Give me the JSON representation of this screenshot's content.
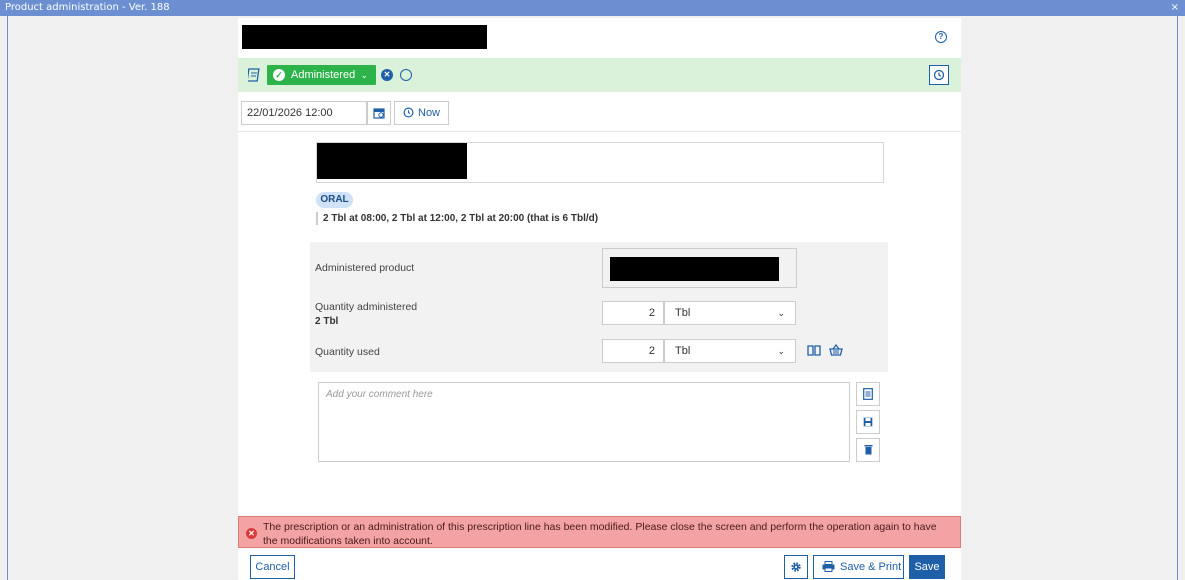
{
  "window": {
    "title": "Product administration - Ver. 188",
    "close_label": "×"
  },
  "status": {
    "label": "Administered"
  },
  "datetime": {
    "value": "22/01/2026 12:00",
    "now_label": "Now"
  },
  "prescription": {
    "route": "ORAL",
    "dosage": "2 Tbl at 08:00, 2 Tbl at 12:00, 2 Tbl at 20:00 (that is 6 Tbl/d)"
  },
  "administration": {
    "product_label": "Administered product",
    "qty_admin_label": "Quantity administered",
    "qty_admin_sub": "2 Tbl",
    "qty_admin_value": "2",
    "qty_admin_unit": "Tbl",
    "qty_used_label": "Quantity used",
    "qty_used_value": "2",
    "qty_used_unit": "Tbl"
  },
  "comment": {
    "placeholder": "Add your comment here"
  },
  "error": {
    "message": "The prescription or an administration of this prescription line has been modified. Please close the screen and perform the operation again to have the modifications taken into account."
  },
  "footer": {
    "cancel": "Cancel",
    "save_print": "Save & Print",
    "save": "Save"
  },
  "colors": {
    "accent": "#1f5fa8",
    "success": "#2db34a",
    "status_bg": "#d9f2d9",
    "error_bg": "#f3a3a3",
    "titlebar": "#6b8fd1"
  }
}
